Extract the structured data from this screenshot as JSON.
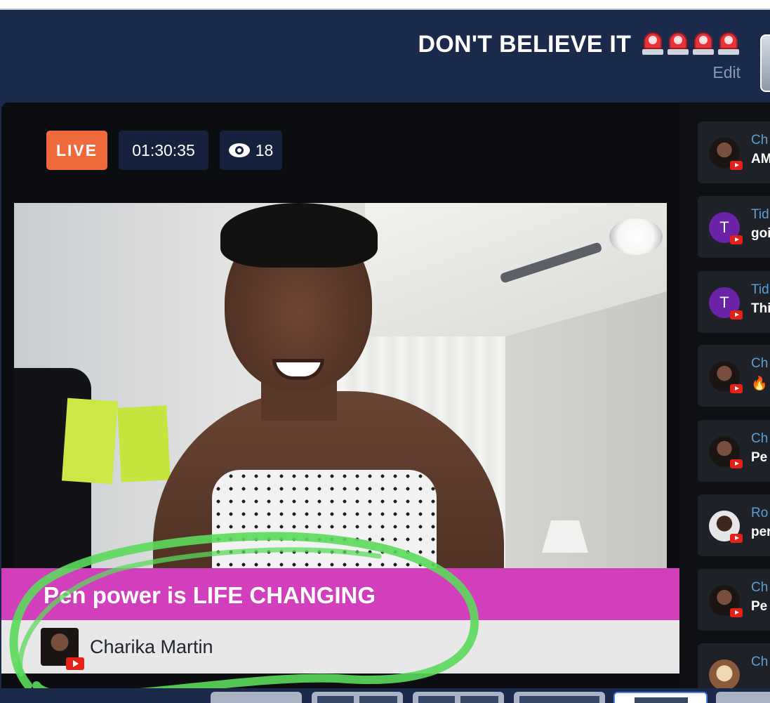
{
  "header": {
    "title": "DON'T BELIEVE IT",
    "title_emoji_icons": [
      "siren-icon",
      "siren-icon",
      "siren-icon",
      "siren-icon"
    ],
    "edit_label": "Edit"
  },
  "stage": {
    "live_label": "LIVE",
    "elapsed_time": "01:30:35",
    "viewer_count": "18"
  },
  "lower_third": {
    "title": "Pen power is LIFE CHANGING",
    "presenter_name": "Charika Martin"
  },
  "chat": {
    "messages": [
      {
        "name": "Ch",
        "text": "AM",
        "avatar": "photo"
      },
      {
        "name": "Tid",
        "text": "goi",
        "avatar": "letter",
        "letter": "T"
      },
      {
        "name": "Tid",
        "text": "Thi",
        "avatar": "letter",
        "letter": "T"
      },
      {
        "name": "Ch",
        "text": "🔥🔥",
        "avatar": "photo"
      },
      {
        "name": "Ch",
        "text": "Pe",
        "avatar": "photo"
      },
      {
        "name": "Ro",
        "text": "per",
        "avatar": "photo2"
      },
      {
        "name": "Ch",
        "text": "Pe",
        "avatar": "photo"
      },
      {
        "name": "Ch",
        "text": "",
        "avatar": "photo3"
      }
    ]
  },
  "colors": {
    "background": "#1b2a4b",
    "live_badge": "#ef6b3c",
    "lower_third_banner": "#d23fbd",
    "annotation_stroke": "#5bd95b",
    "chat_name": "#5aa0d8"
  }
}
